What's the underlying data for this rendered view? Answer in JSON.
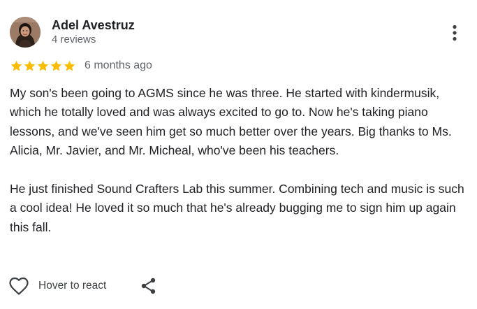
{
  "reviewer": {
    "name": "Adel Avestruz",
    "review_count": "4 reviews",
    "avatar_icon": "profile-photo"
  },
  "rating": {
    "stars": 5,
    "max_stars": 5,
    "star_color": "#fbbc04",
    "date": "6 months ago"
  },
  "review": {
    "paragraphs": [
      "My son's been going to AGMS since he was three. He started with kindermusik, which he totally loved and was always excited to go to. Now he's taking piano lessons, and we've seen him get so much better over the years. Big thanks to Ms. Alicia, Mr. Javier, and Mr. Micheal, who've been his teachers.",
      "He just finished Sound Crafters Lab this summer. Combining tech and music is such a cool idea! He loved it so much that he's already bugging me to sign him up again this fall."
    ]
  },
  "actions": {
    "react_label": "Hover to react",
    "react_icon": "heart-outline-icon",
    "share_icon": "share-icon",
    "more_icon": "more-vert-icon"
  }
}
